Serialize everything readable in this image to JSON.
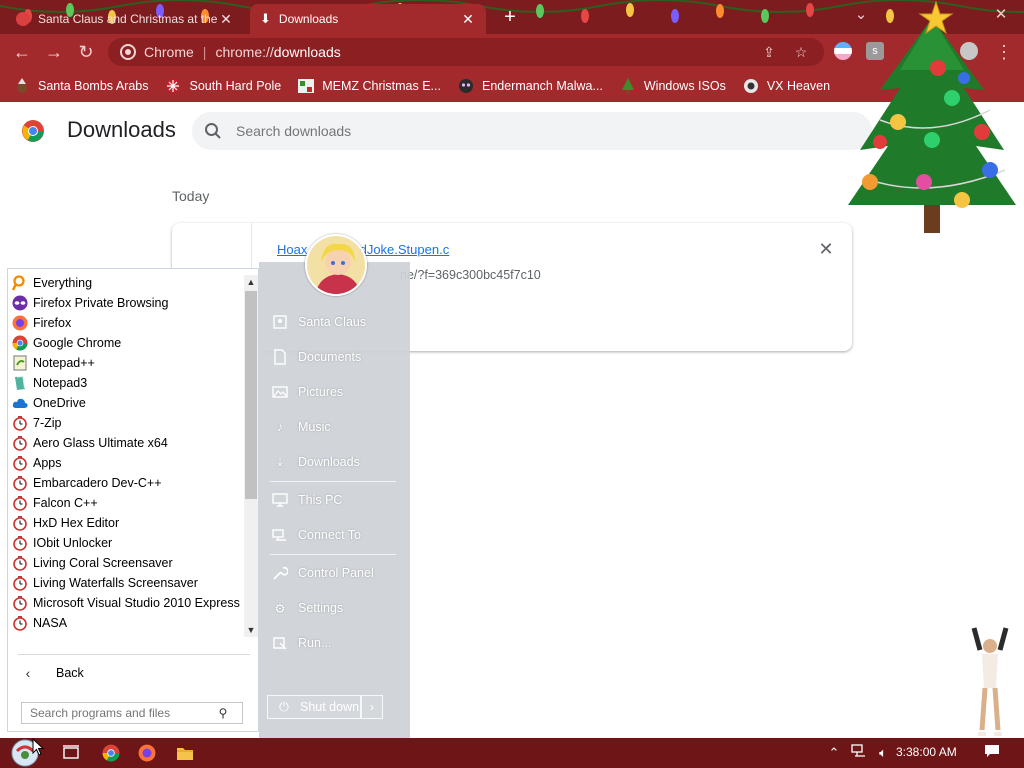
{
  "tabs": [
    {
      "title": "Santa Claus and Christmas at the",
      "active": false
    },
    {
      "title": "Downloads",
      "active": true
    }
  ],
  "address": {
    "site": "Chrome",
    "scheme": "chrome://",
    "path": "downloads"
  },
  "bookmarks": [
    {
      "label": "Santa Bombs Arabs",
      "icon": "santa-icon"
    },
    {
      "label": "South Hard Pole",
      "icon": "snowflake-icon"
    },
    {
      "label": "MEMZ Christmas E...",
      "icon": "memz-icon"
    },
    {
      "label": "Endermanch Malwa...",
      "icon": "enderman-icon"
    },
    {
      "label": "Windows ISOs",
      "icon": "tree-icon"
    },
    {
      "label": "VX Heaven",
      "icon": "vx-icon"
    }
  ],
  "downloads_page": {
    "title": "Downloads",
    "search_placeholder": "Search downloads",
    "section": "Today",
    "item": {
      "filename_start": "Hoax",
      "filename_end": "adJoke.Stupen.c",
      "url_fragment": "ne/?f=369c300bc45f7c10"
    }
  },
  "start_menu": {
    "programs": [
      {
        "label": "Everything",
        "icon": "everything-icon"
      },
      {
        "label": "Firefox Private Browsing",
        "icon": "firefox-private-icon"
      },
      {
        "label": "Firefox",
        "icon": "firefox-icon"
      },
      {
        "label": "Google Chrome",
        "icon": "chrome-icon"
      },
      {
        "label": "Notepad++",
        "icon": "notepadpp-icon"
      },
      {
        "label": "Notepad3",
        "icon": "notepad3-icon"
      },
      {
        "label": "OneDrive",
        "icon": "onedrive-icon"
      },
      {
        "label": "7-Zip",
        "icon": "folder-clock-icon"
      },
      {
        "label": "Aero Glass Ultimate x64",
        "icon": "folder-clock-icon"
      },
      {
        "label": "Apps",
        "icon": "folder-clock-icon"
      },
      {
        "label": "Embarcadero Dev-C++",
        "icon": "folder-clock-icon"
      },
      {
        "label": "Falcon C++",
        "icon": "folder-clock-icon"
      },
      {
        "label": "HxD Hex Editor",
        "icon": "folder-clock-icon"
      },
      {
        "label": "IObit Unlocker",
        "icon": "folder-clock-icon"
      },
      {
        "label": "Living Coral Screensaver",
        "icon": "folder-clock-icon"
      },
      {
        "label": "Living Waterfalls Screensaver",
        "icon": "folder-clock-icon"
      },
      {
        "label": "Microsoft Visual Studio 2010 Express",
        "icon": "folder-clock-icon"
      },
      {
        "label": "NASA",
        "icon": "folder-clock-icon"
      }
    ],
    "back_label": "Back",
    "search_placeholder": "Search programs and files",
    "right_items": [
      {
        "label": "Santa Claus",
        "icon": "user-folder-icon"
      },
      {
        "label": "Documents",
        "icon": "documents-icon"
      },
      {
        "label": "Pictures",
        "icon": "pictures-icon"
      },
      {
        "label": "Music",
        "icon": "music-icon"
      },
      {
        "label": "Downloads",
        "icon": "downloads-icon"
      },
      {
        "label": "This PC",
        "icon": "computer-icon"
      },
      {
        "label": "Connect To",
        "icon": "network-icon"
      },
      {
        "label": "Control Panel",
        "icon": "wrench-icon"
      },
      {
        "label": "Settings",
        "icon": "gear-icon"
      },
      {
        "label": "Run...",
        "icon": "run-icon"
      }
    ],
    "shutdown_label": "Shut down"
  },
  "taskbar": {
    "clock": "3:38:00 AM"
  },
  "colors": {
    "titlebar": "#7d1c1e",
    "toolbar": "#a32a2c",
    "taskbar": "#6e1517",
    "link": "#1a73e8"
  }
}
